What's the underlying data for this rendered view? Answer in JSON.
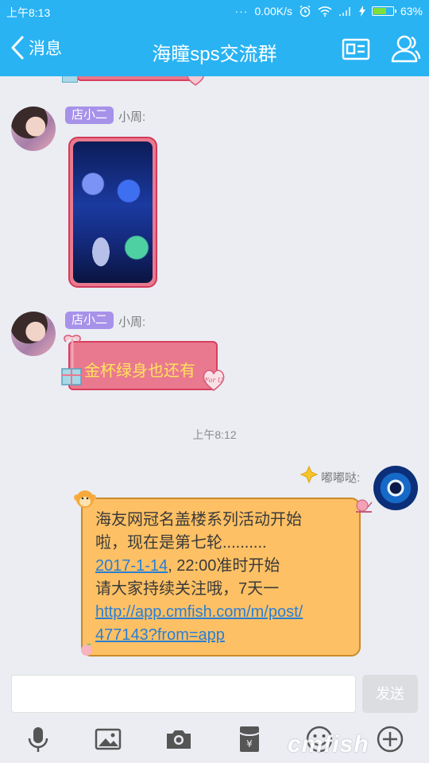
{
  "status_bar": {
    "time": "上午8:13",
    "dots": "···",
    "net_speed": "0.00K/s",
    "battery": "63%",
    "battery_level": 0.63
  },
  "title_bar": {
    "back_label": "消息",
    "title": "海瞳sps交流群"
  },
  "messages": [
    {
      "tag": "店小二",
      "nick": "小周:"
    },
    {
      "tag": "店小二",
      "nick": "小周:",
      "text": "金杯绿身也还有"
    }
  ],
  "timestamp": "上午8:12",
  "my_message": {
    "nick": "嘟嘟哒:",
    "line1": "海友网冠名盖楼系列活动开始",
    "line2": "啦，现在是第七轮..........",
    "date_link": "2017-1-14",
    "after_date": ", 22:00准时开始",
    "line4": "请大家持续关注哦，7天一",
    "url_line1": "http://app.cmfish.com/m/post/",
    "url_line2": "477143?from=app"
  },
  "decor": {
    "for_u": "For U"
  },
  "input_bar": {
    "placeholder": "",
    "send_label": "发送"
  },
  "watermark": "cmfish",
  "icons": [
    "back-chevron-icon",
    "card-icon",
    "people-icon",
    "mic-icon",
    "image-icon",
    "camera-icon",
    "red-packet-icon",
    "emoji-icon",
    "plus-icon"
  ],
  "colors": {
    "header": "#29b3f3",
    "tag": "#a792ea",
    "pink_bubble": "#e9798e",
    "yellow_bubble": "#fdc064",
    "link": "#2a7fd4",
    "background": "#ebedf3"
  }
}
